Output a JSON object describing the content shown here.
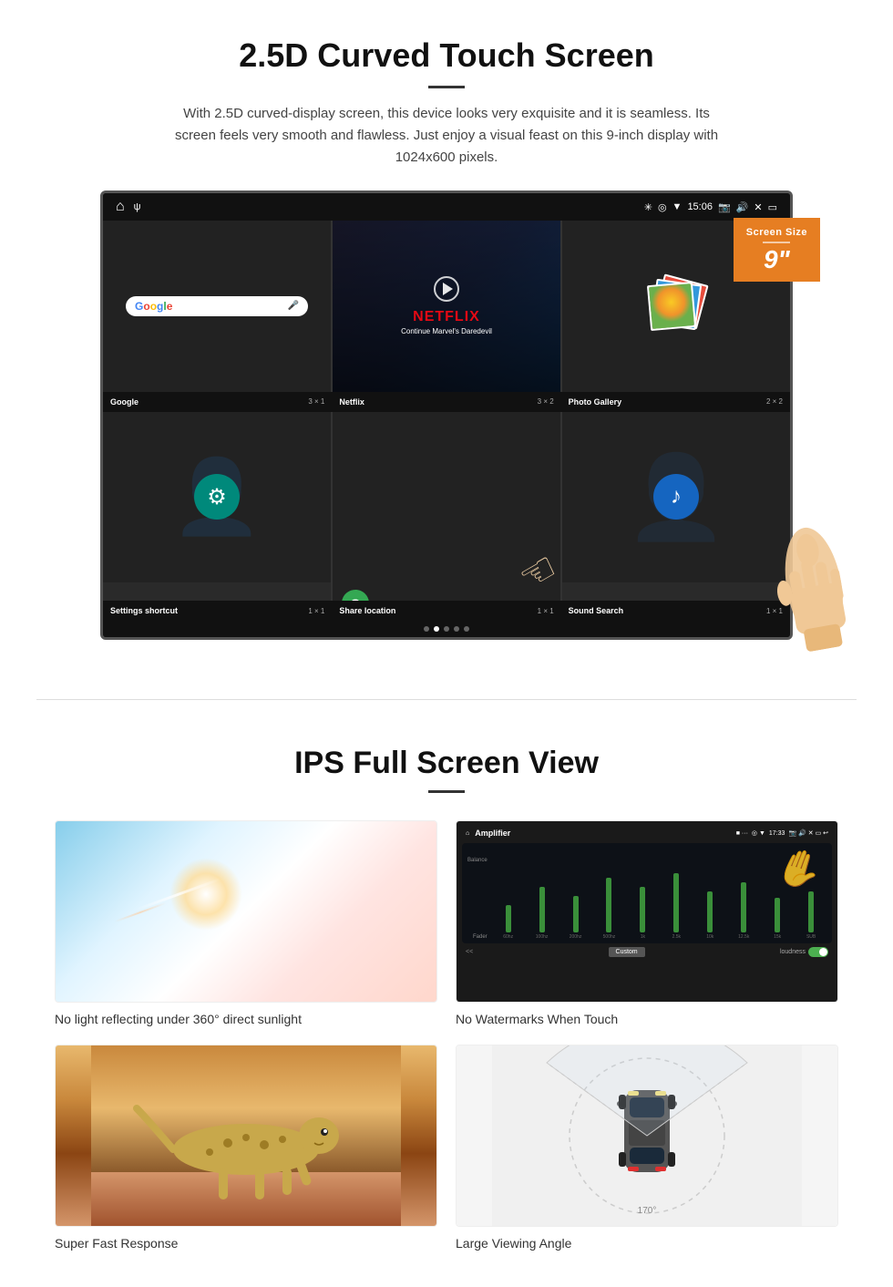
{
  "section1": {
    "title": "2.5D Curved Touch Screen",
    "description": "With 2.5D curved-display screen, this device looks very exquisite and it is seamless. Its screen feels very smooth and flawless. Just enjoy a visual feast on this 9-inch display with 1024x600 pixels.",
    "screen_size_label": "Screen Size",
    "screen_size_value": "9\"",
    "status_bar": {
      "time": "15:06",
      "icons": "✳ ◎ ▼ 📷 🔊 ✕ ▭"
    },
    "apps": [
      {
        "name": "Google",
        "size": "3 × 1",
        "type": "google"
      },
      {
        "name": "Netflix",
        "size": "3 × 2",
        "type": "netflix",
        "subtitle": "Continue Marvel's Daredevil"
      },
      {
        "name": "Photo Gallery",
        "size": "2 × 2",
        "type": "gallery"
      },
      {
        "name": "Settings shortcut",
        "size": "1 × 1",
        "type": "settings"
      },
      {
        "name": "Share location",
        "size": "1 × 1",
        "type": "share"
      },
      {
        "name": "Sound Search",
        "size": "1 × 1",
        "type": "sound"
      }
    ]
  },
  "section2": {
    "title": "IPS Full Screen View",
    "items": [
      {
        "caption": "No light reflecting under 360° direct sunlight",
        "type": "sky"
      },
      {
        "caption": "No Watermarks When Touch",
        "type": "amplifier"
      },
      {
        "caption": "Super Fast Response",
        "type": "cheetah"
      },
      {
        "caption": "Large Viewing Angle",
        "type": "car"
      }
    ]
  }
}
